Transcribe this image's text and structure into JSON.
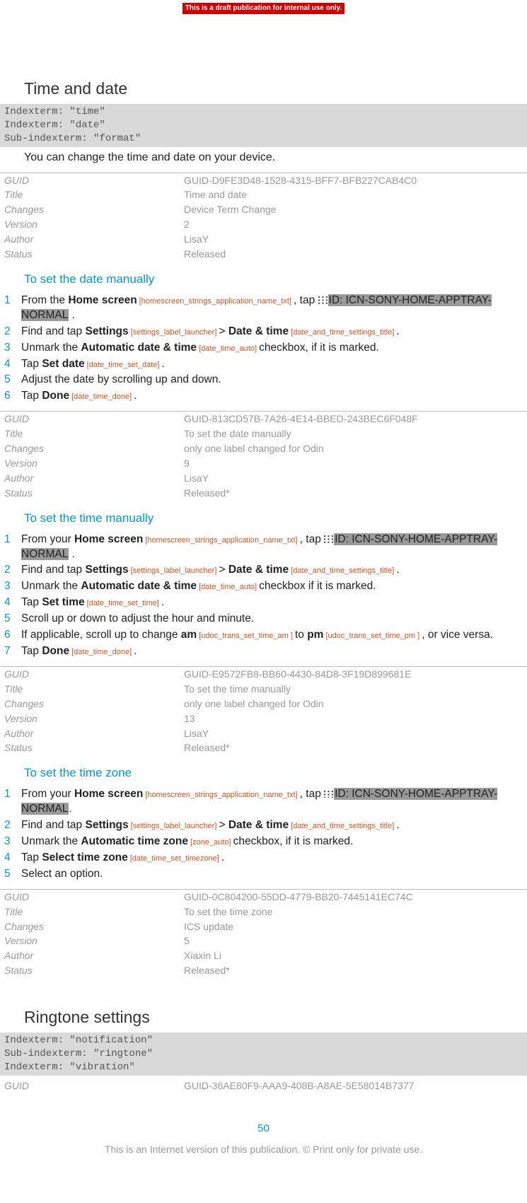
{
  "banner": "This is a draft publication for internal use only.",
  "section1": {
    "title": "Time and date",
    "indexterms": "Indexterm: \"time\"\nIndexterm: \"date\"\nSub-indexterm: \"format\"",
    "intro": "You can change the time and date on your device.",
    "meta": {
      "guid_label": "GUID",
      "guid": "GUID-D9FE3D48-1528-4315-BFF7-BFB227CAB4C0",
      "title_label": "Title",
      "title": "Time and date",
      "changes_label": "Changes",
      "changes": "Device Term Change",
      "version_label": "Version",
      "version": "2",
      "author_label": "Author",
      "author": "LisaY",
      "status_label": "Status",
      "status": "Released"
    }
  },
  "task1": {
    "title": "To set the date manually",
    "steps": {
      "s1a": "From the ",
      "s1b": "Home screen",
      "s1ref1": " [homescreen_strings_application_name_txt] ",
      "s1c": ", tap ",
      "s1icn": "ID: ICN-SONY-HOME-APPTRAY-NORMAL",
      "s1d": " .",
      "s2a": "Find and tap ",
      "s2b": "Settings",
      "s2ref1": " [settings_label_launcher] ",
      "s2c": "> ",
      "s2d": "Date & time",
      "s2ref2": " [date_and_time_settings_title] ",
      "s2e": ".",
      "s3a": "Unmark the ",
      "s3b": "Automatic date & time",
      "s3ref1": " [date_time_auto] ",
      "s3c": "checkbox, if it is marked.",
      "s4a": "Tap ",
      "s4b": "Set date",
      "s4ref1": " [date_time_set_date] ",
      "s4c": ".",
      "s5a": "Adjust the date by scrolling up and down.",
      "s6a": "Tap ",
      "s6b": "Done",
      "s6ref1": " [date_time_done] ",
      "s6c": "."
    },
    "meta": {
      "guid_label": "GUID",
      "guid": "GUID-813CD57B-7A26-4E14-BBED-243BEC6F048F",
      "title_label": "Title",
      "title": "To set the date manually",
      "changes_label": "Changes",
      "changes": "only one label changed for Odin",
      "version_label": "Version",
      "version": "9",
      "author_label": "Author",
      "author": "LisaY",
      "status_label": "Status",
      "status": "Released*"
    }
  },
  "task2": {
    "title": "To set the time manually",
    "steps": {
      "s1a": "From your ",
      "s1b": "Home screen",
      "s1ref1": " [homescreen_strings_application_name_txt] ",
      "s1c": ", tap ",
      "s1icn": "ID: ICN-SONY-HOME-APPTRAY-NORMAL",
      "s1d": " .",
      "s2a": "Find and tap ",
      "s2b": "Settings",
      "s2ref1": " [settings_label_launcher] ",
      "s2c": "> ",
      "s2d": "Date & time",
      "s2ref2": " [date_and_time_settings_title] ",
      "s2e": ".",
      "s3a": "Unmark the ",
      "s3b": "Automatic date & time",
      "s3ref1": " [date_time_auto] ",
      "s3c": "checkbox if it is marked.",
      "s4a": "Tap ",
      "s4b": "Set time",
      "s4ref1": " [date_time_set_time] ",
      "s4c": ".",
      "s5a": "Scroll up or down to adjust the hour and minute.",
      "s6a": "If applicable, scroll up to change ",
      "s6b": "am",
      "s6ref1": " [udoc_trans_set_time_am ] ",
      "s6c": "to ",
      "s6d": "pm",
      "s6ref2": " [udoc_trans_set_time_pm ] ",
      "s6e": ", or vice versa.",
      "s7a": "Tap ",
      "s7b": "Done",
      "s7ref1": " [date_time_done] ",
      "s7c": "."
    },
    "meta": {
      "guid_label": "GUID",
      "guid": "GUID-E9572FB8-BB60-4430-84D8-3F19D899681E",
      "title_label": "Title",
      "title": "To set the time manually",
      "changes_label": "Changes",
      "changes": "only one label changed for Odin",
      "version_label": "Version",
      "version": "13",
      "author_label": "Author",
      "author": "LisaY",
      "status_label": "Status",
      "status": "Released*"
    }
  },
  "task3": {
    "title": "To set the time zone",
    "steps": {
      "s1a": "From your ",
      "s1b": "Home screen",
      "s1ref1": " [homescreen_strings_application_name_txt] ",
      "s1c": ", tap ",
      "s1icn": "ID: ICN-SONY-HOME-APPTRAY-NORMAL",
      "s1d": ".",
      "s2a": "Find and tap ",
      "s2b": "Settings",
      "s2ref1": " [settings_label_launcher] ",
      "s2c": "> ",
      "s2d": "Date & time",
      "s2ref2": " [date_and_time_settings_title] ",
      "s2e": ".",
      "s3a": "Unmark the ",
      "s3b": "Automatic time zone",
      "s3ref1": " [zone_auto] ",
      "s3c": "checkbox, if it is marked.",
      "s4a": "Tap ",
      "s4b": "Select time zone",
      "s4ref1": " [date_time_set_timezone] ",
      "s4c": ".",
      "s5a": "Select an option."
    },
    "meta": {
      "guid_label": "GUID",
      "guid": "GUID-0C804200-55DD-4779-BB20-7445141EC74C",
      "title_label": "Title",
      "title": "To set the time zone",
      "changes_label": "Changes",
      "changes": "ICS update",
      "version_label": "Version",
      "version": "5",
      "author_label": "Author",
      "author": "Xiaxin Li",
      "status_label": "Status",
      "status": "Released*"
    }
  },
  "section2": {
    "title": "Ringtone settings",
    "indexterms": "Indexterm: \"notification\"\nSub-indexterm: \"ringtone\"\nIndexterm: \"vibration\"",
    "meta": {
      "guid_label": "GUID",
      "guid": "GUID-36AE80F9-AAA9-408B-A8AE-5E58014B7377"
    }
  },
  "page_number": "50",
  "footer": "This is an Internet version of this publication. © Print only for private use."
}
